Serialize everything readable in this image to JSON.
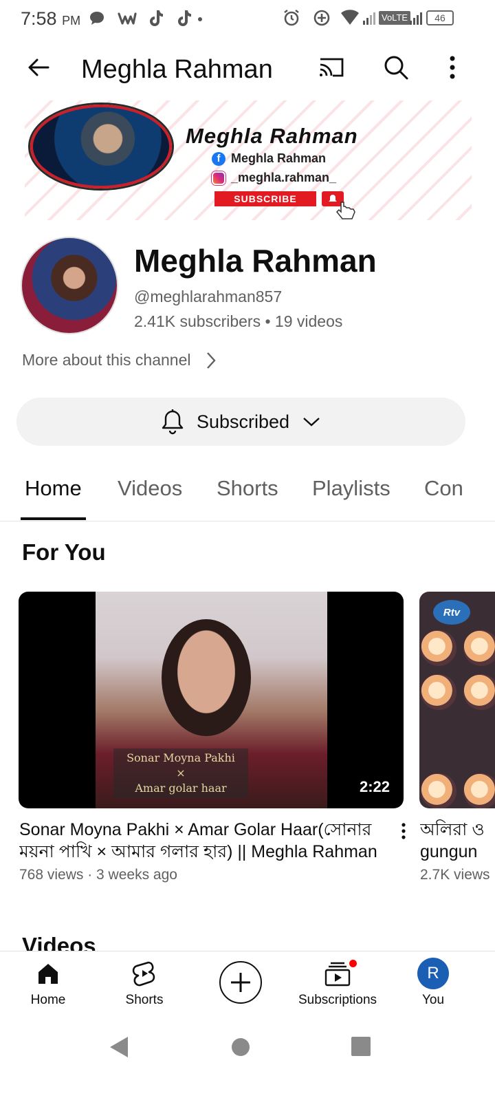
{
  "status_bar": {
    "time": "7:58",
    "ampm": "PM",
    "volte": "VoLTE",
    "battery": "46"
  },
  "app_bar": {
    "title": "Meghla Rahman"
  },
  "banner": {
    "name": "Meghla Rahman",
    "facebook": "Meghla Rahman",
    "instagram": "_meghla.rahman_",
    "subscribe": "SUBSCRIBE"
  },
  "channel": {
    "name": "Meghla Rahman",
    "handle": "@meghlarahman857",
    "stats": "2.41K subscribers • 19 videos",
    "more_about": "More about this channel",
    "subscribe_label": "Subscribed"
  },
  "tabs": [
    {
      "label": "Home",
      "active": true
    },
    {
      "label": "Videos",
      "active": false
    },
    {
      "label": "Shorts",
      "active": false
    },
    {
      "label": "Playlists",
      "active": false
    },
    {
      "label": "Con",
      "active": false
    }
  ],
  "for_you": {
    "title": "For You",
    "videos": [
      {
        "title": "Sonar Moyna Pakhi × Amar Golar Haar(সোনার ময়না পাখি × আমার গলার হার) || Meghla Rahman",
        "meta": "768 views · 3 weeks ago",
        "duration": "2:22",
        "caption_line1": "Sonar Moyna Pakhi",
        "caption_line2": "×",
        "caption_line3": "Amar golar haar"
      },
      {
        "title": "অলিরা ও gungun",
        "title_line1": "অলিরা ও",
        "title_line2": "gungun",
        "meta": "2.7K views",
        "logo": "Rtv"
      }
    ]
  },
  "videos_section": {
    "title": "Videos"
  },
  "bottom_nav": [
    {
      "label": "Home",
      "icon": "home-icon"
    },
    {
      "label": "Shorts",
      "icon": "shorts-icon"
    },
    {
      "label": "",
      "icon": "create-icon"
    },
    {
      "label": "Subscriptions",
      "icon": "subscriptions-icon"
    },
    {
      "label": "You",
      "icon": "you-avatar",
      "initial": "R"
    }
  ],
  "colors": {
    "text_primary": "#0f0f0f",
    "text_secondary": "#606060",
    "subscribe_pill": "#f2f2f2",
    "notification_dot": "#ff0000",
    "you_avatar": "#1a5fb4"
  }
}
